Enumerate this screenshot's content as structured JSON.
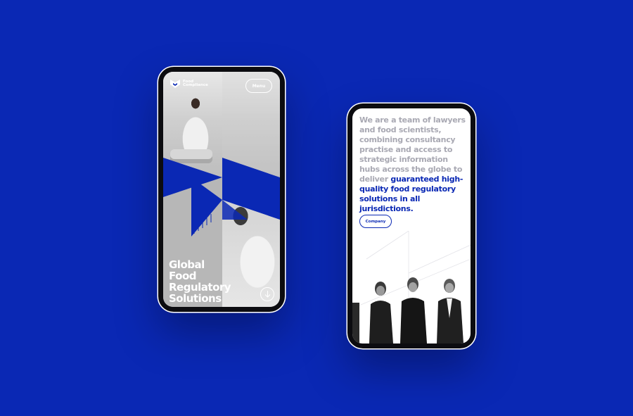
{
  "colors": {
    "background": "#0a28b4",
    "accent": "#0a28b4",
    "muted_text": "#a9a9b3",
    "white": "#ffffff"
  },
  "hero_screen": {
    "brand": {
      "line1": "Food",
      "line2": "Compliance",
      "icon": "shield-logo-icon"
    },
    "menu_label": "Menu",
    "title_lines": [
      "Global",
      "Food",
      "Regulatory",
      "Solutions"
    ],
    "scroll_icon": "arrow-down-icon"
  },
  "company_screen": {
    "intro_muted": "We are a team of lawyers and food scientists, combining consultancy practise and access to strategic information hubs across the globe to deliver",
    "intro_strong": "guaranteed high-quality food regulatory solutions in all jurisdictions.",
    "company_button": "Company"
  }
}
